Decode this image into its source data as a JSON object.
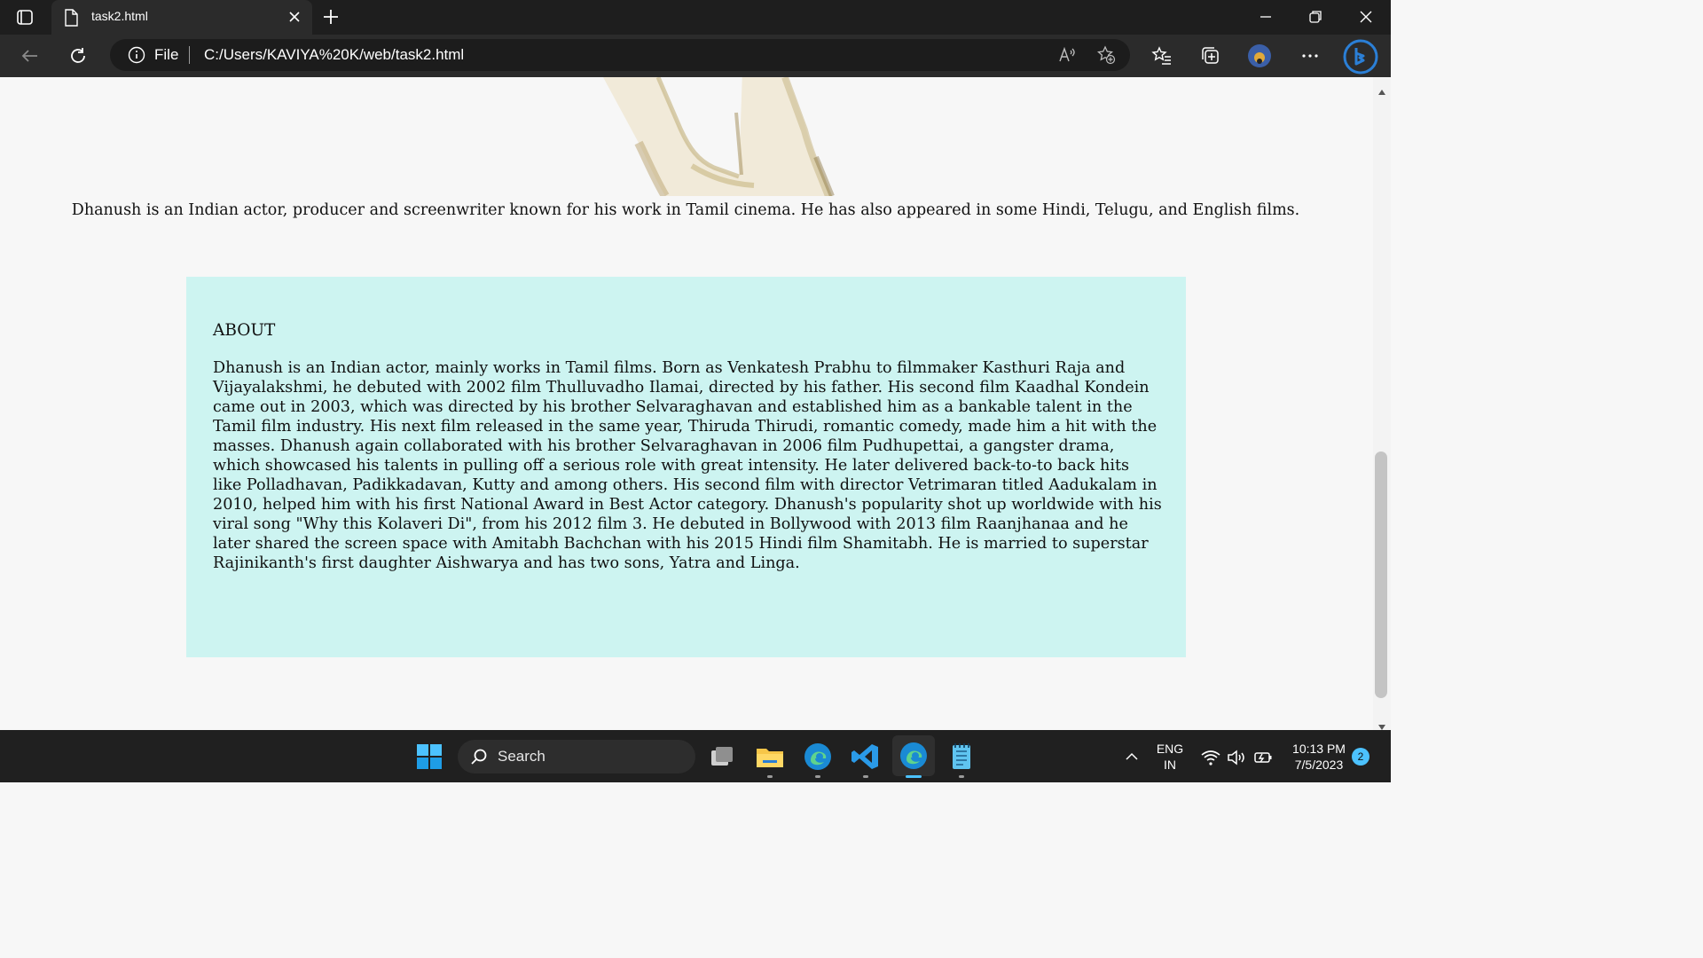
{
  "browser": {
    "tab_title": "task2.html",
    "address_scheme": "File",
    "address_url": "C:/Users/KAVIYA%20K/web/task2.html"
  },
  "page": {
    "intro_text": "Dhanush is an Indian actor, producer and screenwriter known for his work in Tamil cinema. He has also appeared in some Hindi, Telugu, and English films.",
    "about_heading": "ABOUT",
    "about_body": "Dhanush is an Indian actor, mainly works in Tamil films. Born as Venkatesh Prabhu to filmmaker Kasthuri Raja and Vijayalakshmi, he debuted with 2002 film Thulluvadho Ilamai, directed by his father. His second film Kaadhal Kondein came out in 2003, which was directed by his brother Selvaraghavan and established him as a bankable talent in the Tamil film industry. His next film released in the same year, Thiruda Thirudi, romantic comedy, made him a hit with the masses. Dhanush again collaborated with his brother Selvaraghavan in 2006 film Pudhupettai, a gangster drama, which showcased his talents in pulling off a serious role with great intensity. He later delivered back-to-to back hits like Polladhavan, Padikkadavan, Kutty and among others. His second film with director Vetrimaran titled Aadukalam in 2010, helped him with his first National Award in Best Actor category. Dhanush's popularity shot up worldwide with his viral song \"Why this Kolaveri Di\", from his 2012 film 3. He debuted in Bollywood with 2013 film Raanjhanaa and he later shared the screen space with Amitabh Bachchan with his 2015 Hindi film Shamitabh. He is married to superstar Rajinikanth's first daughter Aishwarya and has two sons, Yatra and Linga.",
    "about_bg": "#cdf4f1"
  },
  "taskbar": {
    "search_label": "Search",
    "lang_line1": "ENG",
    "lang_line2": "IN",
    "time": "10:13 PM",
    "date": "7/5/2023",
    "notification_count": "2"
  },
  "icons": [
    "tab-actions-icon",
    "page-icon",
    "close-icon",
    "plus-icon",
    "minimize-icon",
    "restore-icon",
    "back-icon",
    "refresh-icon",
    "info-icon",
    "read-aloud-icon",
    "add-favorite-icon",
    "favorites-icon",
    "collections-icon",
    "profile-avatar",
    "more-icon",
    "bing-icon",
    "windows-start-icon",
    "search-icon",
    "task-view-icon",
    "file-explorer-icon",
    "edge-icon",
    "vscode-icon",
    "notepad-icon",
    "chevron-up-icon",
    "wifi-icon",
    "volume-icon",
    "battery-icon"
  ]
}
